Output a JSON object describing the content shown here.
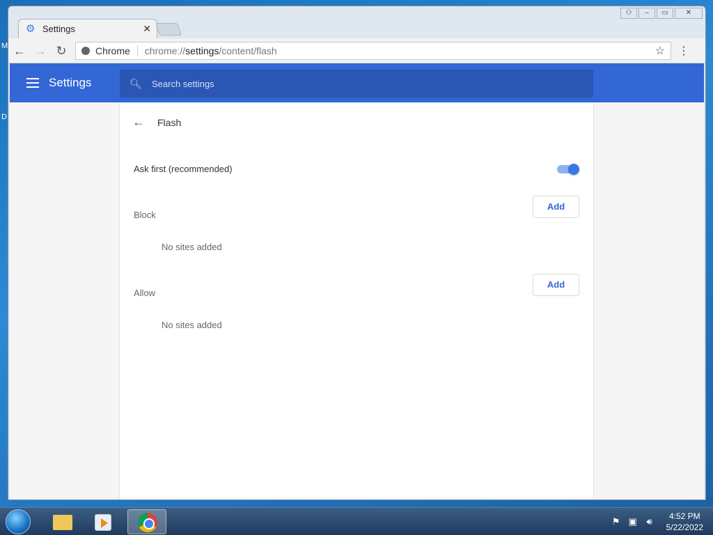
{
  "desktop": {
    "edge_text_1": "M",
    "edge_text_2": "D"
  },
  "browser": {
    "tab": {
      "title": "Settings",
      "close": "✕"
    },
    "window_controls": {
      "user": "⚇",
      "minimize": "–",
      "maximize": "▭",
      "close": "✕"
    },
    "omnibox": {
      "scheme_label": "Chrome",
      "url_prefix": "chrome://",
      "url_host": "settings",
      "url_path": "/content/flash"
    }
  },
  "settings": {
    "header_title": "Settings",
    "search_placeholder": "Search settings",
    "page_title": "Flash",
    "ask_first_label": "Ask first (recommended)",
    "ask_first_enabled": true,
    "block_label": "Block",
    "block_add": "Add",
    "block_empty": "No sites added",
    "allow_label": "Allow",
    "allow_add": "Add",
    "allow_empty": "No sites added"
  },
  "taskbar": {
    "time": "4:52 PM",
    "date": "5/22/2022"
  },
  "colors": {
    "header_blue": "#3367d6",
    "toggle_blue": "#3b78e7"
  }
}
